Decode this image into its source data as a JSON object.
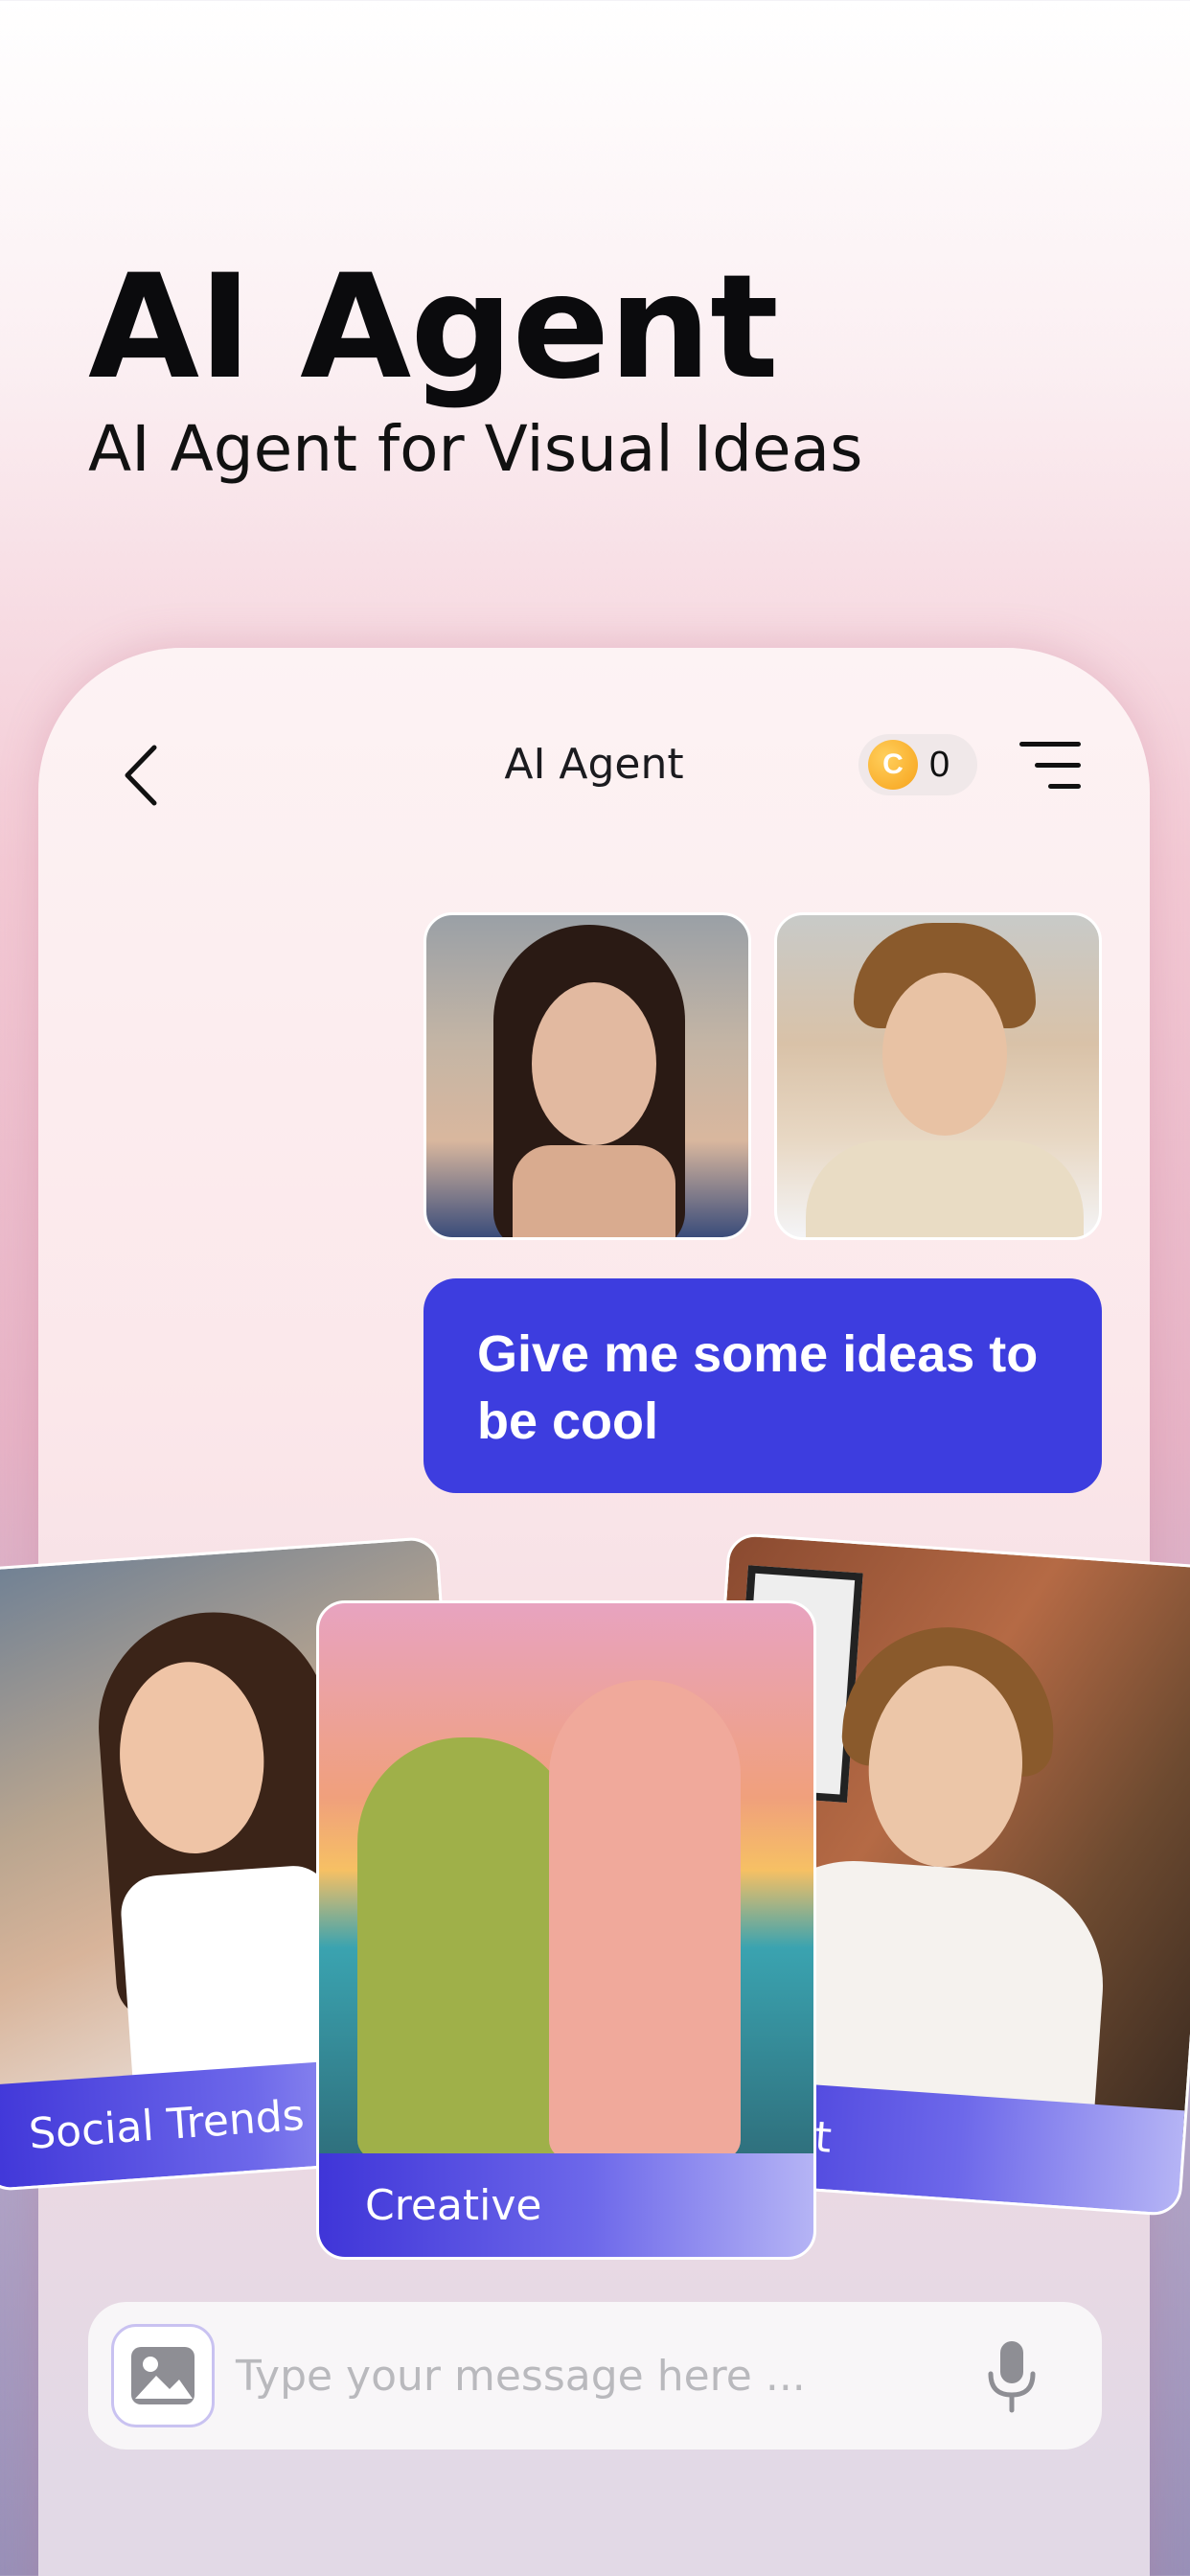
{
  "hero": {
    "title": "AI Agent",
    "subtitle": "AI Agent for Visual Ideas"
  },
  "topbar": {
    "title": "AI Agent",
    "coin_symbol": "C",
    "coin_count": "0",
    "back_icon": "chevron-left-icon",
    "menu_icon": "menu-icon"
  },
  "chat": {
    "user_message": "Give me some ideas to be cool",
    "bubble_color": "#3d3ddf"
  },
  "idea_cards": [
    {
      "label": "Social Trends"
    },
    {
      "label": "Creative"
    },
    {
      "label": "Host"
    }
  ],
  "composer": {
    "placeholder": "Type your message here ...",
    "image_icon": "image-icon",
    "mic_icon": "microphone-icon"
  }
}
